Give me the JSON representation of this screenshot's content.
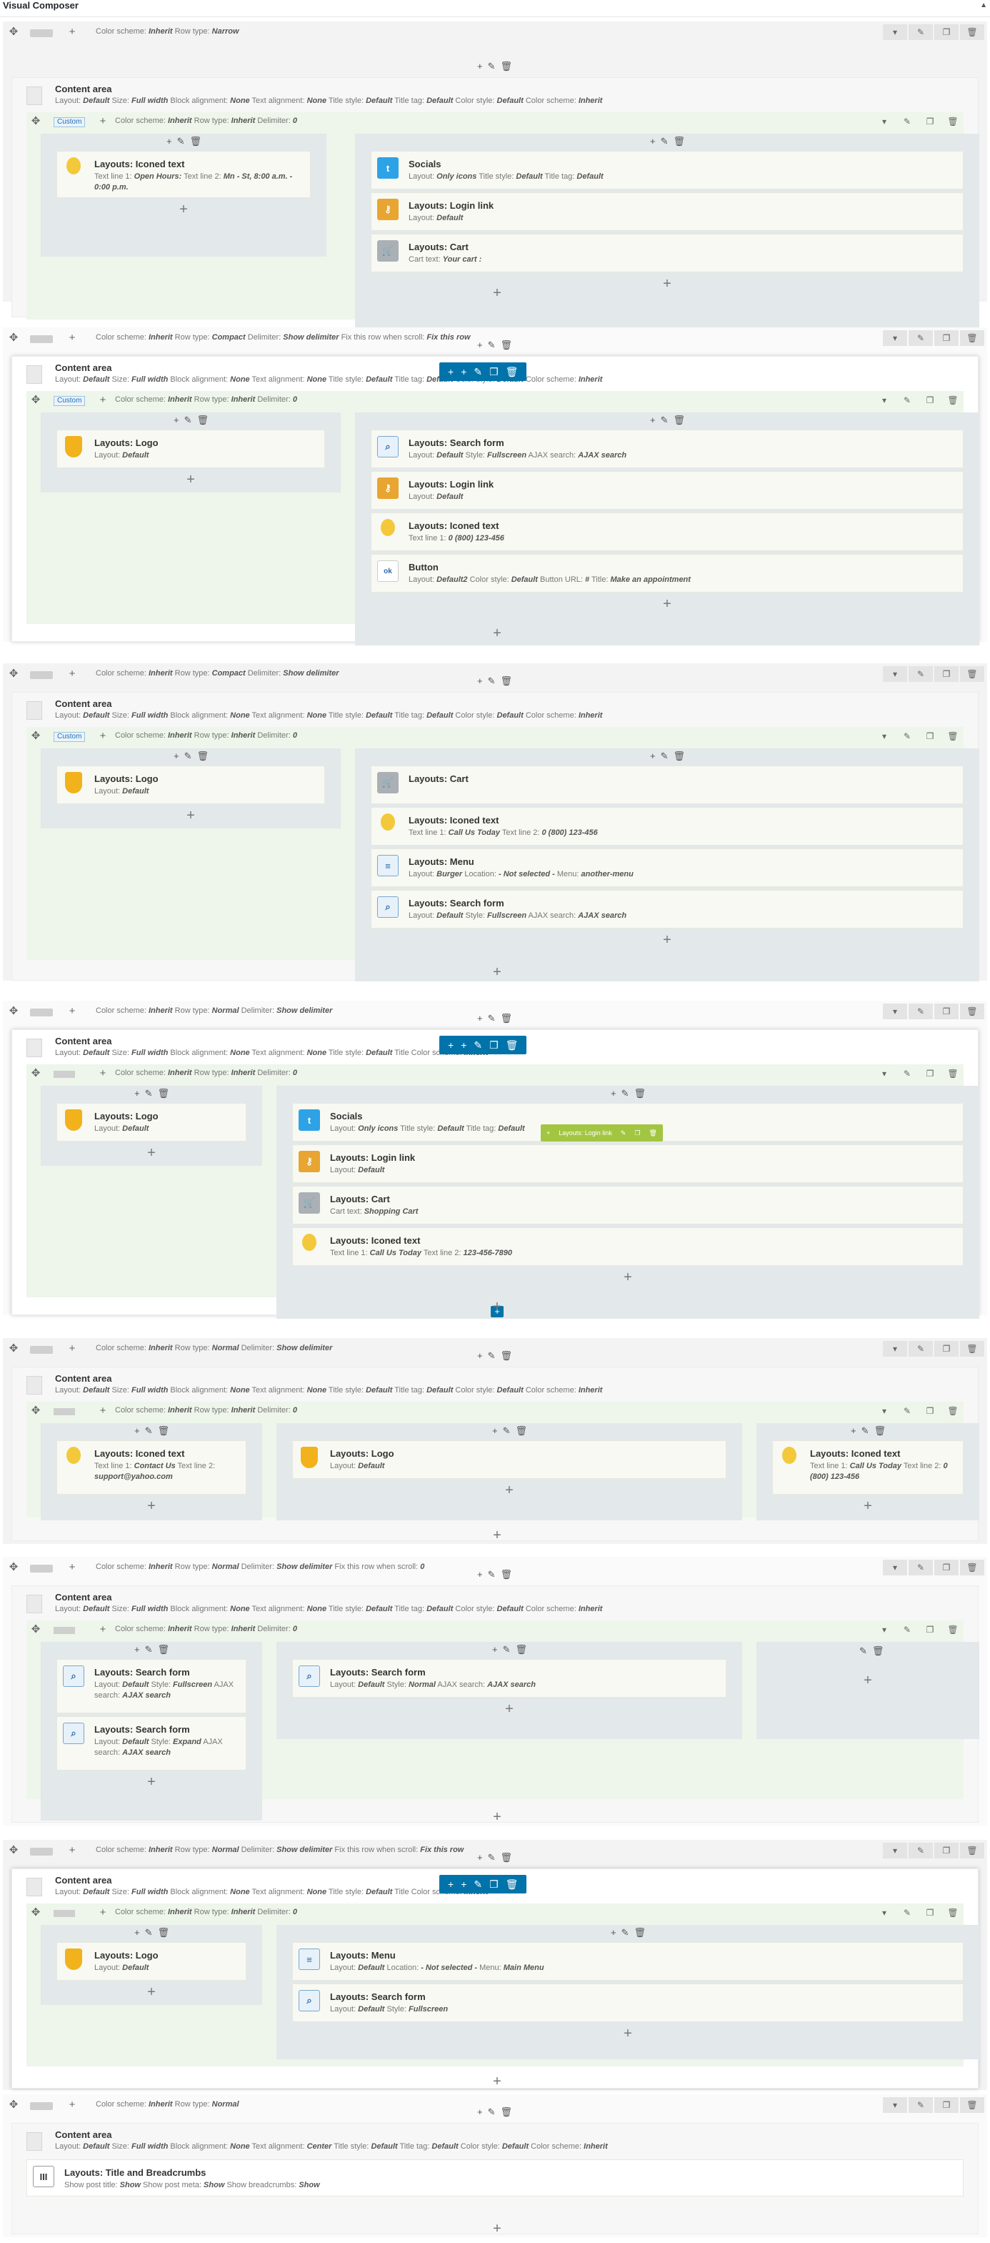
{
  "panel": {
    "title": "Visual Composer",
    "caret": "▲"
  },
  "tools": {
    "add": "+",
    "edit": "✎",
    "del": "🗑",
    "move": "✥",
    "copy": "❐",
    "drop": "▾"
  },
  "content_area": {
    "title": "Content area"
  },
  "rows": [
    {
      "id": "r1",
      "info": [
        [
          "Color scheme: ",
          "Inherit"
        ],
        [
          " Row type: ",
          "Narrow"
        ]
      ],
      "ca_info": [
        [
          "Layout: ",
          "Default"
        ],
        [
          " Size: ",
          "Full width"
        ],
        [
          " Block alignment: ",
          "None"
        ],
        [
          " Text alignment: ",
          "None"
        ],
        [
          " Title style: ",
          "Default"
        ],
        [
          " Title tag: ",
          "Default"
        ],
        [
          " Color style: ",
          "Default"
        ],
        [
          " Color scheme: ",
          "Inherit"
        ]
      ],
      "inner_tag": "Custom",
      "inner_info": [
        [
          "Color scheme: ",
          "Inherit"
        ],
        [
          " Row type: ",
          "Inherit"
        ],
        [
          " Delimiter: ",
          "0"
        ]
      ],
      "cols": [
        [
          {
            "icon": "bulb",
            "title": "Layouts: Iconed text",
            "info": [
              [
                "Text line 1: ",
                "Open Hours:"
              ],
              [
                " Text line 2: ",
                "Mn - St, 8:00 a.m. - 0:00 p.m."
              ]
            ]
          }
        ],
        [
          {
            "icon": "tw",
            "title": "Socials",
            "info": [
              [
                "Layout: ",
                "Only icons"
              ],
              [
                " Title style: ",
                "Default"
              ],
              [
                " Title tag: ",
                "Default"
              ]
            ]
          },
          {
            "icon": "key",
            "title": "Layouts: Login link",
            "info": [
              [
                "Layout: ",
                "Default"
              ]
            ]
          },
          {
            "icon": "cart",
            "title": "Layouts: Cart",
            "info": [
              [
                "Cart text: ",
                "Your cart :"
              ]
            ]
          }
        ]
      ]
    },
    {
      "id": "r2",
      "info": [
        [
          "Color scheme: ",
          "Inherit"
        ],
        [
          " Row type: ",
          "Compact"
        ],
        [
          " Delimiter: ",
          "Show delimiter"
        ],
        [
          " Fix this row when scroll: ",
          "Fix this row"
        ]
      ],
      "ca_info": [
        [
          "Layout: ",
          "Default"
        ],
        [
          " Size: ",
          "Full width"
        ],
        [
          " Block alignment: ",
          "None"
        ],
        [
          " Text alignment: ",
          "None"
        ],
        [
          " Title style: ",
          "Default"
        ],
        [
          " Title tag: ",
          "Default"
        ],
        [
          " Color style: ",
          "Default"
        ],
        [
          " Color scheme: ",
          "Inherit"
        ]
      ],
      "inner_tag": "Custom",
      "inner_info": [
        [
          "Color scheme: ",
          "Inherit"
        ],
        [
          " Row type: ",
          "Inherit"
        ],
        [
          " Delimiter: ",
          "0"
        ]
      ],
      "cols": [
        [
          {
            "icon": "logo",
            "title": "Layouts: Logo",
            "info": [
              [
                "Layout: ",
                "Default"
              ]
            ]
          }
        ],
        [
          {
            "icon": "search",
            "title": "Layouts: Search form",
            "info": [
              [
                "Layout: ",
                "Default"
              ],
              [
                " Style: ",
                "Fullscreen"
              ],
              [
                " AJAX search: ",
                "AJAX search"
              ]
            ]
          },
          {
            "icon": "key",
            "title": "Layouts: Login link",
            "info": [
              [
                "Layout: ",
                "Default"
              ]
            ]
          },
          {
            "icon": "bulb",
            "title": "Layouts: Iconed text",
            "info": [
              [
                "Text line 1: ",
                "0 (800) 123-456"
              ]
            ]
          },
          {
            "icon": "btn",
            "title": "Button",
            "info": [
              [
                "Layout: ",
                "Default2"
              ],
              [
                " Color style: ",
                "Default"
              ],
              [
                " Button URL: ",
                "#"
              ],
              [
                " Title: ",
                "Make an appointment"
              ]
            ]
          }
        ]
      ]
    },
    {
      "id": "r3",
      "info": [
        [
          "Color scheme: ",
          "Inherit"
        ],
        [
          " Row type: ",
          "Compact"
        ],
        [
          " Delimiter: ",
          "Show delimiter"
        ]
      ],
      "ca_info": [
        [
          "Layout: ",
          "Default"
        ],
        [
          " Size: ",
          "Full width"
        ],
        [
          " Block alignment: ",
          "None"
        ],
        [
          " Text alignment: ",
          "None"
        ],
        [
          " Title style: ",
          "Default"
        ],
        [
          " Title tag: ",
          "Default"
        ],
        [
          " Color style: ",
          "Default"
        ],
        [
          " Color scheme: ",
          "Inherit"
        ]
      ],
      "inner_tag": "Custom",
      "inner_info": [
        [
          "Color scheme: ",
          "Inherit"
        ],
        [
          " Row type: ",
          "Inherit"
        ],
        [
          " Delimiter: ",
          "0"
        ]
      ],
      "cols": [
        [
          {
            "icon": "logo",
            "title": "Layouts: Logo",
            "info": [
              [
                "Layout: ",
                "Default"
              ]
            ]
          }
        ],
        [
          {
            "icon": "cart",
            "title": "Layouts: Cart",
            "info": []
          },
          {
            "icon": "bulb",
            "title": "Layouts: Iconed text",
            "info": [
              [
                "Text line 1: ",
                "Call Us Today"
              ],
              [
                " Text line 2: ",
                "0 (800) 123-456"
              ]
            ]
          },
          {
            "icon": "menu",
            "title": "Layouts: Menu",
            "info": [
              [
                "Layout: ",
                "Burger"
              ],
              [
                " Location: ",
                "- Not selected -"
              ],
              [
                " Menu: ",
                "another-menu"
              ]
            ]
          },
          {
            "icon": "search",
            "title": "Layouts: Search form",
            "info": [
              [
                "Layout: ",
                "Default"
              ],
              [
                " Style: ",
                "Fullscreen"
              ],
              [
                " AJAX search: ",
                "AJAX search"
              ]
            ]
          }
        ]
      ]
    },
    {
      "id": "r4",
      "info": [
        [
          "Color scheme: ",
          "Inherit"
        ],
        [
          " Row type: ",
          "Normal"
        ],
        [
          " Delimiter: ",
          "Show delimiter"
        ]
      ],
      "ca_info": [
        [
          "Layout: ",
          "Default"
        ],
        [
          " Size: ",
          "Full width"
        ],
        [
          " Block alignment: ",
          "None"
        ],
        [
          " Text alignment: ",
          "None"
        ],
        [
          " Title style: ",
          "Default"
        ],
        [
          " Title ",
          ""
        ],
        [
          "Color scheme: ",
          "Inherit"
        ]
      ],
      "inner_tag": "",
      "inner_info": [
        [
          "Color scheme: ",
          "Inherit"
        ],
        [
          " Row type: ",
          "Inherit"
        ],
        [
          " Delimiter: ",
          "0"
        ]
      ],
      "cols": [
        [
          {
            "icon": "logo",
            "title": "Layouts: Logo",
            "info": [
              [
                "Layout: ",
                "Default"
              ]
            ]
          }
        ],
        [
          {
            "icon": "tw",
            "title": "Socials",
            "info": [
              [
                "Layout: ",
                "Only icons"
              ],
              [
                " Title style: ",
                "Default"
              ],
              [
                " Title tag: ",
                "Default"
              ]
            ]
          },
          {
            "icon": "key",
            "title": "Layouts: Login link",
            "info": [
              [
                "Layout: ",
                "Default"
              ]
            ]
          },
          {
            "icon": "cart",
            "title": "Layouts: Cart",
            "info": [
              [
                "Cart text: ",
                "Shopping Cart"
              ]
            ]
          },
          {
            "icon": "bulb",
            "title": "Layouts: Iconed text",
            "info": [
              [
                "Text line 1: ",
                "Call Us Today"
              ],
              [
                " Text line 2: ",
                "123-456-7890"
              ]
            ]
          }
        ]
      ],
      "green_label": "Layouts: Login link"
    },
    {
      "id": "r5",
      "info": [
        [
          "Color scheme: ",
          "Inherit"
        ],
        [
          " Row type: ",
          "Normal"
        ],
        [
          " Delimiter: ",
          "Show delimiter"
        ]
      ],
      "ca_info": [
        [
          "Layout: ",
          "Default"
        ],
        [
          " Size: ",
          "Full width"
        ],
        [
          " Block alignment: ",
          "None"
        ],
        [
          " Text alignment: ",
          "None"
        ],
        [
          " Title style: ",
          "Default"
        ],
        [
          " Title tag: ",
          "Default"
        ],
        [
          " Color style: ",
          "Default"
        ],
        [
          " Color scheme: ",
          "Inherit"
        ]
      ],
      "inner_tag": "",
      "inner_info": [
        [
          "Color scheme: ",
          "Inherit"
        ],
        [
          " Row type: ",
          "Inherit"
        ],
        [
          " Delimiter: ",
          "0"
        ]
      ],
      "cols": [
        [
          {
            "icon": "bulb",
            "title": "Layouts: Iconed text",
            "info": [
              [
                "Text line 1: ",
                "Contact Us"
              ],
              [
                " Text line 2: ",
                "support@yahoo.com"
              ]
            ]
          }
        ],
        [
          {
            "icon": "logo",
            "title": "Layouts: Logo",
            "info": [
              [
                "Layout: ",
                "Default"
              ]
            ]
          }
        ],
        [
          {
            "icon": "bulb",
            "title": "Layouts: Iconed text",
            "info": [
              [
                "Text line 1: ",
                "Call Us Today"
              ],
              [
                " Text line 2: ",
                "0 (800) 123-456"
              ]
            ]
          }
        ]
      ]
    },
    {
      "id": "r6",
      "info": [
        [
          "Color scheme: ",
          "Inherit"
        ],
        [
          " Row type: ",
          "Normal"
        ],
        [
          " Delimiter: ",
          "Show delimiter"
        ],
        [
          " Fix this row when scroll: ",
          "0"
        ]
      ],
      "ca_info": [
        [
          "Layout: ",
          "Default"
        ],
        [
          " Size: ",
          "Full width"
        ],
        [
          " Block alignment: ",
          "None"
        ],
        [
          " Text alignment: ",
          "None"
        ],
        [
          " Title style: ",
          "Default"
        ],
        [
          " Title tag: ",
          "Default"
        ],
        [
          " Color style: ",
          "Default"
        ],
        [
          " Color scheme: ",
          "Inherit"
        ]
      ],
      "inner_tag": "",
      "inner_info": [
        [
          "Color scheme: ",
          "Inherit"
        ],
        [
          " Row type: ",
          "Inherit"
        ],
        [
          " Delimiter: ",
          "0"
        ]
      ],
      "cols": [
        [
          {
            "icon": "search",
            "title": "Layouts: Search form",
            "info": [
              [
                "Layout: ",
                "Default"
              ],
              [
                " Style: ",
                "Fullscreen"
              ],
              [
                " AJAX search: ",
                "AJAX search"
              ]
            ]
          },
          {
            "icon": "search",
            "title": "Layouts: Search form",
            "info": [
              [
                "Layout: ",
                "Default"
              ],
              [
                " Style: ",
                "Expand"
              ],
              [
                " AJAX search: ",
                "AJAX search"
              ]
            ]
          }
        ],
        [
          {
            "icon": "search",
            "title": "Layouts: Search form",
            "info": [
              [
                "Layout: ",
                "Default"
              ],
              [
                " Style: ",
                "Normal"
              ],
              [
                " AJAX search: ",
                "AJAX search"
              ]
            ]
          }
        ],
        []
      ]
    },
    {
      "id": "r7",
      "info": [
        [
          "Color scheme: ",
          "Inherit"
        ],
        [
          " Row type: ",
          "Normal"
        ],
        [
          " Delimiter: ",
          "Show delimiter"
        ],
        [
          " Fix this row when scroll: ",
          "Fix this row"
        ]
      ],
      "ca_info": [
        [
          "Layout: ",
          "Default"
        ],
        [
          " Size: ",
          "Full width"
        ],
        [
          " Block alignment: ",
          "None"
        ],
        [
          " Text alignment: ",
          "None"
        ],
        [
          " Title style: ",
          "Default"
        ],
        [
          " Title ",
          ""
        ],
        [
          "Color scheme: ",
          "Inherit"
        ]
      ],
      "inner_tag": "",
      "inner_info": [
        [
          "Color scheme: ",
          "Inherit"
        ],
        [
          " Row type: ",
          "Inherit"
        ],
        [
          " Delimiter: ",
          "0"
        ]
      ],
      "cols": [
        [
          {
            "icon": "logo",
            "title": "Layouts: Logo",
            "info": [
              [
                "Layout: ",
                "Default"
              ]
            ]
          }
        ],
        [
          {
            "icon": "menu",
            "title": "Layouts: Menu",
            "info": [
              [
                "Layout: ",
                "Default"
              ],
              [
                " Location: ",
                "- Not selected -"
              ],
              [
                " Menu: ",
                "Main Menu"
              ]
            ]
          },
          {
            "icon": "search",
            "title": "Layouts: Search form",
            "info": [
              [
                "Layout: ",
                "Default"
              ],
              [
                " Style: ",
                "Fullscreen"
              ]
            ]
          }
        ]
      ]
    },
    {
      "id": "r8",
      "info": [
        [
          "Color scheme: ",
          "Inherit"
        ],
        [
          " Row type: ",
          "Normal"
        ]
      ],
      "ca_info": [
        [
          "Layout: ",
          "Default"
        ],
        [
          " Size: ",
          "Full width"
        ],
        [
          " Block alignment: ",
          "None"
        ],
        [
          " Text alignment: ",
          "Center"
        ],
        [
          " Title style: ",
          "Default"
        ],
        [
          " Title tag: ",
          "Default"
        ],
        [
          " Color style: ",
          "Default"
        ],
        [
          " Color scheme: ",
          "Inherit"
        ]
      ],
      "title_breadcrumbs": {
        "title": "Layouts: Title and Breadcrumbs",
        "info": [
          [
            "Show post title: ",
            "Show"
          ],
          [
            " Show post meta: ",
            "Show"
          ],
          [
            " Show breadcrumbs: ",
            "Show"
          ]
        ]
      }
    }
  ]
}
